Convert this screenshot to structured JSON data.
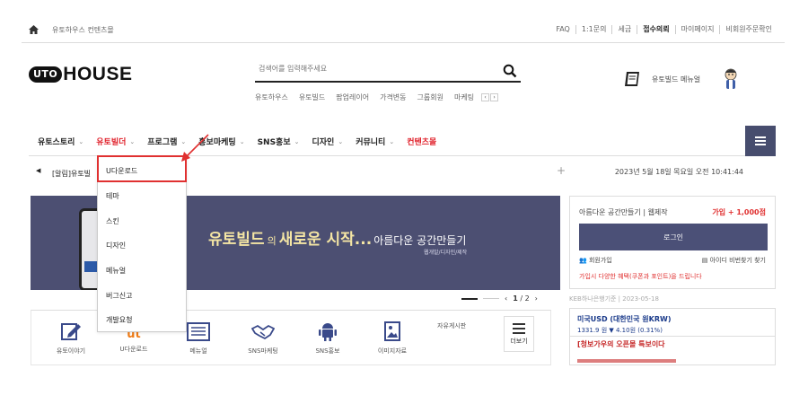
{
  "topbar": {
    "crumb": "유토하우스 컨텐츠몰",
    "links": [
      "FAQ",
      "1:1문의",
      "세금",
      "접수의뢰",
      "마이페이지",
      "비회원주문확인"
    ]
  },
  "header": {
    "logo_badge": "UTO",
    "logo_text": "HOUSE",
    "search_placeholder": "검색어를 입력해주세요",
    "keywords": [
      "유토하우스",
      "유토빌드",
      "팝업레이어",
      "가격변동",
      "그룹회원",
      "마케팅"
    ],
    "kw_prev": "‹",
    "kw_next": "›",
    "menual_label": "유토빌드 메뉴얼"
  },
  "nav": {
    "items": [
      "유토스토리",
      "유토빌더",
      "프로그램",
      "홍보마케팅",
      "SNS홍보",
      "디자인",
      "커뮤니티",
      "컨텐츠몰"
    ],
    "caret": "⌄"
  },
  "dropdown": {
    "items": [
      "U다운로드",
      "테마",
      "스킨",
      "디자인",
      "메뉴얼",
      "버그신고",
      "개발요청"
    ]
  },
  "notice": {
    "bullet": "◀",
    "text": "[알림]유토빌",
    "plus": "+",
    "date": "2023년 5월 18일 목요일 오전 10:41:44"
  },
  "banner": {
    "t1": "유토빌드",
    "t2": "의",
    "t3": "새로운 시작...",
    "t4": "아름다운 공간만들기",
    "sub": "웹개발/디자인/제작"
  },
  "pager": {
    "current": "1",
    "sep": "/",
    "total": "2",
    "prev": "‹",
    "next": "›"
  },
  "quick": {
    "items": [
      "유토이야기",
      "U다운로드",
      "메뉴얼",
      "SNS마케팅",
      "SNS홍보",
      "이미지자료"
    ],
    "free_board": "자유게시판",
    "more": "더보기"
  },
  "login": {
    "lead": "아름다운 공간만들기 | 웹제작",
    "bonus": "가입 + 1,000점",
    "button": "로그인",
    "join": "회원가입",
    "find": "아이디 비번찾기 찾기",
    "promo": "가입시 다양한 혜택(쿠폰과 포인트)을 드립니다"
  },
  "rate": {
    "caption": "KEB하나은행기준 | 2023-05-18",
    "title": "미국USD (대한민국 원KRW)",
    "value": "1331.9 원 ▼ 4.10원 (0.31%)",
    "news": "[청보가우의 오픈몰 특보이다"
  },
  "colors": {
    "accent": "#4b5077",
    "red": "#e0202a",
    "banner": "#4c4f72"
  }
}
